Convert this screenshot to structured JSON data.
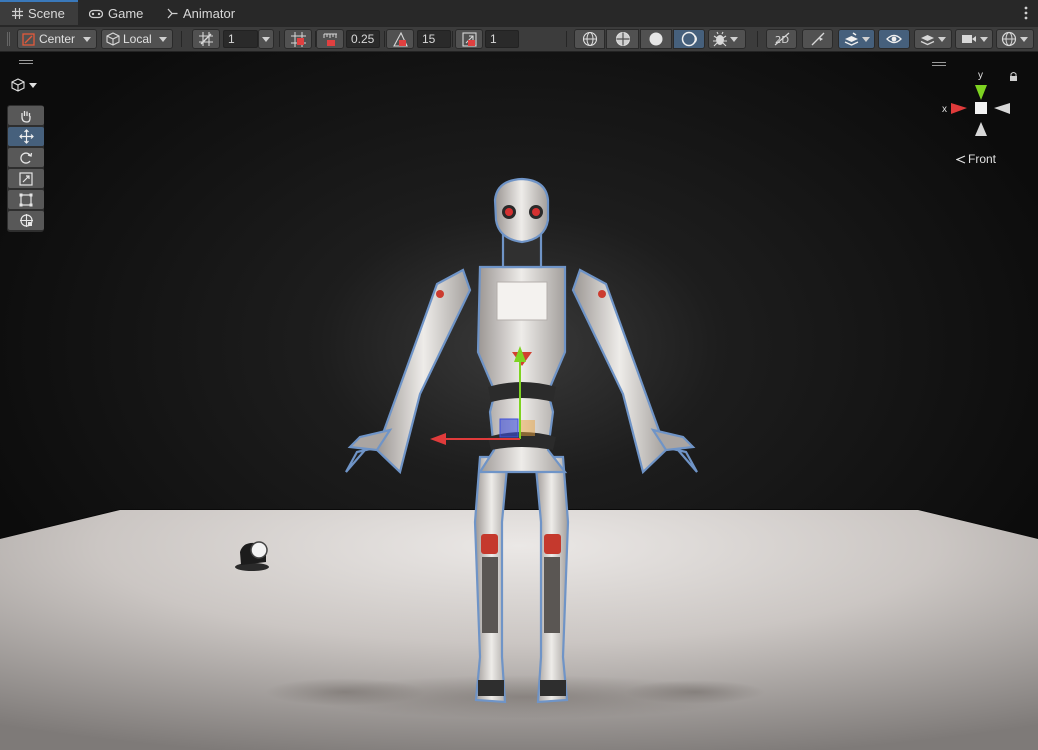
{
  "tabs": [
    {
      "label": "Scene",
      "icon": "grid-icon"
    },
    {
      "label": "Game",
      "icon": "gamepad-icon"
    },
    {
      "label": "Animator",
      "icon": "animator-icon"
    }
  ],
  "toolbar": {
    "pivot_label": "Center",
    "space_label": "Local",
    "grid_size": "1",
    "snap_increment": "0.25",
    "rotate_snap": "15",
    "scale_snap": "1"
  },
  "gizmo": {
    "y_label": "y",
    "x_label": "x",
    "view_label": "Front"
  },
  "colors": {
    "accent": "#46607c",
    "tab_active_border": "#3a79bb",
    "x_axis": "#e03b3b",
    "y_axis": "#7ed321",
    "z_axis": "#3e4fd8"
  }
}
